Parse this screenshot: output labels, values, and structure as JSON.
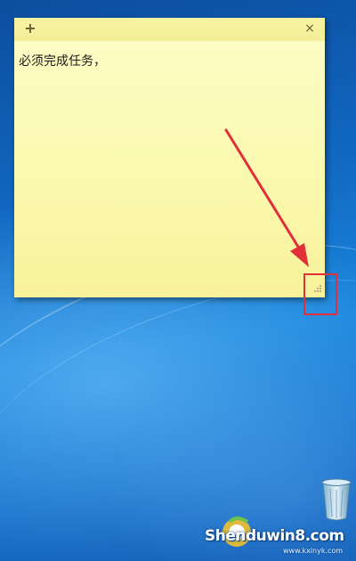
{
  "desktop": {
    "wallpaper": "windows-7-blue",
    "colors": {
      "note_background": "#fbf9b0",
      "annotation_red": "#e0303a"
    }
  },
  "sticky_note": {
    "add_icon": "plus-icon",
    "add_glyph": "+",
    "close_icon": "close-icon",
    "close_glyph": "×",
    "text": "必须完成任务，",
    "resize_icon": "resize-grip-icon"
  },
  "annotation": {
    "arrow": "red-arrow",
    "box": "red-highlight-box"
  },
  "desktop_icons": [
    {
      "name": "recycle-bin",
      "icon": "recycle-bin-icon"
    }
  ],
  "watermark": {
    "text": "Shenduwin8.com",
    "subtext": "www.kxinyk.com"
  }
}
